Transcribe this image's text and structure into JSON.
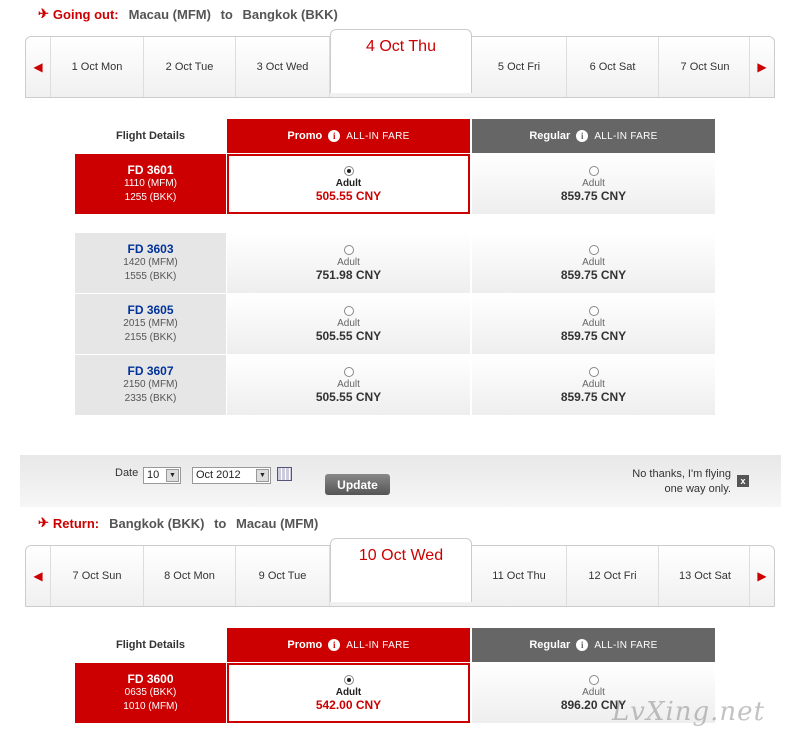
{
  "outbound": {
    "label": "Going out:",
    "from": "Macau (MFM)",
    "to_word": "to",
    "to": "Bangkok (BKK)",
    "days": [
      "1 Oct Mon",
      "2 Oct Tue",
      "3 Oct Wed",
      "4 Oct Thu",
      "5 Oct Fri",
      "6 Oct Sat",
      "7 Oct Sun"
    ],
    "flights": [
      {
        "num": "FD 3601",
        "dep": "1110 (MFM)",
        "arr": "1255 (BKK)",
        "promo_pax": "Adult",
        "promo_price": "505.55 CNY",
        "regular_pax": "Adult",
        "regular_price": "859.75 CNY"
      },
      {
        "num": "FD 3603",
        "dep": "1420 (MFM)",
        "arr": "1555 (BKK)",
        "promo_pax": "Adult",
        "promo_price": "751.98 CNY",
        "regular_pax": "Adult",
        "regular_price": "859.75 CNY"
      },
      {
        "num": "FD 3605",
        "dep": "2015 (MFM)",
        "arr": "2155 (BKK)",
        "promo_pax": "Adult",
        "promo_price": "505.55 CNY",
        "regular_pax": "Adult",
        "regular_price": "859.75 CNY"
      },
      {
        "num": "FD 3607",
        "dep": "2150 (MFM)",
        "arr": "2335 (BKK)",
        "promo_pax": "Adult",
        "promo_price": "505.55 CNY",
        "regular_pax": "Adult",
        "regular_price": "859.75 CNY"
      }
    ]
  },
  "return": {
    "label": "Return:",
    "from": "Bangkok (BKK)",
    "to_word": "to",
    "to": "Macau (MFM)",
    "days": [
      "7 Oct Sun",
      "8 Oct Mon",
      "9 Oct Tue",
      "10 Oct Wed",
      "11 Oct Thu",
      "12 Oct Fri",
      "13 Oct Sat"
    ],
    "flights": [
      {
        "num": "FD 3600",
        "dep": "0635 (BKK)",
        "arr": "1010 (MFM)",
        "promo_pax": "Adult",
        "promo_price": "542.00 CNY",
        "regular_pax": "Adult",
        "regular_price": "896.20 CNY"
      }
    ]
  },
  "fare_headers": {
    "details": "Flight Details",
    "promo": "Promo",
    "regular": "Regular",
    "all_in": "ALL-IN FARE",
    "info_glyph": "i"
  },
  "date_bar": {
    "label": "Date",
    "day_value": "10",
    "month_value": "Oct 2012",
    "update": "Update",
    "oneway_line1": "No thanks, I'm flying",
    "oneway_line2": "one way only.",
    "close_glyph": "x"
  },
  "icons": {
    "plane": "✈",
    "arrow_left": "◀",
    "arrow_right": "▶",
    "dropdown": "▼"
  },
  "watermark": "LvXing.net",
  "colors": {
    "accent": "#cc0000",
    "regular": "#666666",
    "flight_link": "#003399"
  }
}
